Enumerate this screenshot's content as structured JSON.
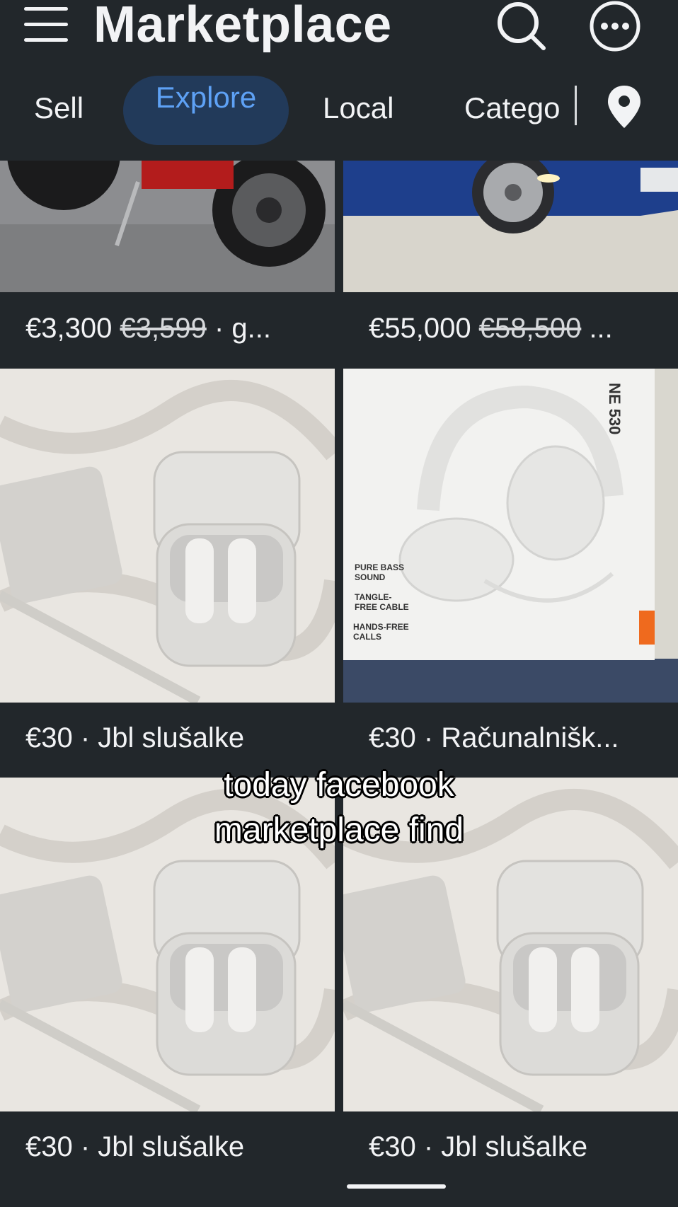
{
  "header": {
    "title": "Marketplace",
    "icons": [
      "menu-icon",
      "search-icon",
      "more-icon"
    ]
  },
  "tabs": [
    {
      "label": "Sell"
    },
    {
      "label": "Explore",
      "active": true
    },
    {
      "label": "Local"
    },
    {
      "label": "Catego"
    }
  ],
  "location_icon": "location-pin-icon",
  "listings": [
    {
      "price": "€3,300",
      "old_price": "€3,599",
      "title": "· g...",
      "image": "motorcycle"
    },
    {
      "price": "€55,000",
      "old_price": "€58,500",
      "title": "...",
      "image": "blue-car"
    },
    {
      "price": "€30",
      "title": "· Jbl slušalke",
      "image": "earbuds"
    },
    {
      "price": "€30",
      "title": "· Računalnišk...",
      "image": "headphones-box"
    },
    {
      "price": "€30",
      "title": "· Jbl slušalke",
      "image": "earbuds"
    },
    {
      "price": "€30",
      "title": "· Jbl slušalke",
      "image": "earbuds"
    }
  ],
  "headphones_box": {
    "model": "NE 530",
    "features": [
      "PURE BASS SOUND",
      "TANGLE-FREE CABLE",
      "HANDS-FREE CALLS"
    ]
  },
  "caption": {
    "line1": "today facebook",
    "line2": "marketplace find"
  },
  "colors": {
    "background": "#22272b",
    "active_tab_bg": "#223a5a",
    "active_tab_text": "#5ea1f5"
  }
}
